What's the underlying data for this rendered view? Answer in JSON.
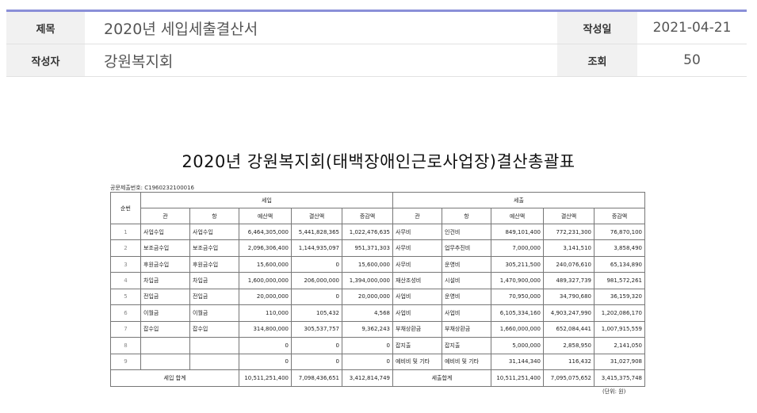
{
  "meta": {
    "title_label": "제목",
    "title_value": "2020년 세입세출결산서",
    "date_label": "작성일",
    "date_value": "2021-04-21",
    "author_label": "작성자",
    "author_value": "강원복지회",
    "views_label": "조회",
    "views_value": "50"
  },
  "document": {
    "title": "2020년 강원복지회(태백장애인근로사업장)결산총괄표",
    "doc_number": "공문제출번호:  C1960232100016",
    "unit": "(단위: 원)",
    "headers": {
      "no": "순번",
      "revenue": "세입",
      "expense": "세출",
      "gwan": "관",
      "hang": "항",
      "budget": "예산액",
      "settled": "결산액",
      "diff": "증감액"
    },
    "rows": [
      {
        "no": "1",
        "r_gwan": "사업수입",
        "r_hang": "사업수입",
        "r_budget": "6,464,305,000",
        "r_settled": "5,441,828,365",
        "r_diff": "1,022,476,635",
        "e_gwan": "사무비",
        "e_hang": "인건비",
        "e_budget": "849,101,400",
        "e_settled": "772,231,300",
        "e_diff": "76,870,100"
      },
      {
        "no": "2",
        "r_gwan": "보조금수입",
        "r_hang": "보조금수입",
        "r_budget": "2,096,306,400",
        "r_settled": "1,144,935,097",
        "r_diff": "951,371,303",
        "e_gwan": "사무비",
        "e_hang": "업무추진비",
        "e_budget": "7,000,000",
        "e_settled": "3,141,510",
        "e_diff": "3,858,490"
      },
      {
        "no": "3",
        "r_gwan": "후원금수입",
        "r_hang": "후원금수입",
        "r_budget": "15,600,000",
        "r_settled": "0",
        "r_diff": "15,600,000",
        "e_gwan": "사무비",
        "e_hang": "운영비",
        "e_budget": "305,211,500",
        "e_settled": "240,076,610",
        "e_diff": "65,134,890"
      },
      {
        "no": "4",
        "r_gwan": "차입금",
        "r_hang": "차입금",
        "r_budget": "1,600,000,000",
        "r_settled": "206,000,000",
        "r_diff": "1,394,000,000",
        "e_gwan": "재산조성비",
        "e_hang": "시설비",
        "e_budget": "1,470,900,000",
        "e_settled": "489,327,739",
        "e_diff": "981,572,261"
      },
      {
        "no": "5",
        "r_gwan": "전입금",
        "r_hang": "전입금",
        "r_budget": "20,000,000",
        "r_settled": "0",
        "r_diff": "20,000,000",
        "e_gwan": "사업비",
        "e_hang": "운영비",
        "e_budget": "70,950,000",
        "e_settled": "34,790,680",
        "e_diff": "36,159,320"
      },
      {
        "no": "6",
        "r_gwan": "이월금",
        "r_hang": "이월금",
        "r_budget": "110,000",
        "r_settled": "105,432",
        "r_diff": "4,568",
        "e_gwan": "사업비",
        "e_hang": "사업비",
        "e_budget": "6,105,334,160",
        "e_settled": "4,903,247,990",
        "e_diff": "1,202,086,170"
      },
      {
        "no": "7",
        "r_gwan": "잡수입",
        "r_hang": "잡수입",
        "r_budget": "314,800,000",
        "r_settled": "305,537,757",
        "r_diff": "9,362,243",
        "e_gwan": "부채상환금",
        "e_hang": "부채상환금",
        "e_budget": "1,660,000,000",
        "e_settled": "652,084,441",
        "e_diff": "1,007,915,559"
      },
      {
        "no": "8",
        "r_gwan": "",
        "r_hang": "",
        "r_budget": "0",
        "r_settled": "0",
        "r_diff": "0",
        "e_gwan": "잡지출",
        "e_hang": "잡지출",
        "e_budget": "5,000,000",
        "e_settled": "2,858,950",
        "e_diff": "2,141,050"
      },
      {
        "no": "9",
        "r_gwan": "",
        "r_hang": "",
        "r_budget": "0",
        "r_settled": "0",
        "r_diff": "0",
        "e_gwan": "예비비 및 기타",
        "e_hang": "예비비 및 기타",
        "e_budget": "31,144,340",
        "e_settled": "116,432",
        "e_diff": "31,027,908"
      }
    ],
    "totals": {
      "r_label": "세입 합계",
      "r_budget": "10,511,251,400",
      "r_settled": "7,098,436,651",
      "r_diff": "3,412,814,749",
      "e_label": "세출합계",
      "e_budget": "10,511,251,400",
      "e_settled": "7,095,075,652",
      "e_diff": "3,415,375,748"
    }
  }
}
